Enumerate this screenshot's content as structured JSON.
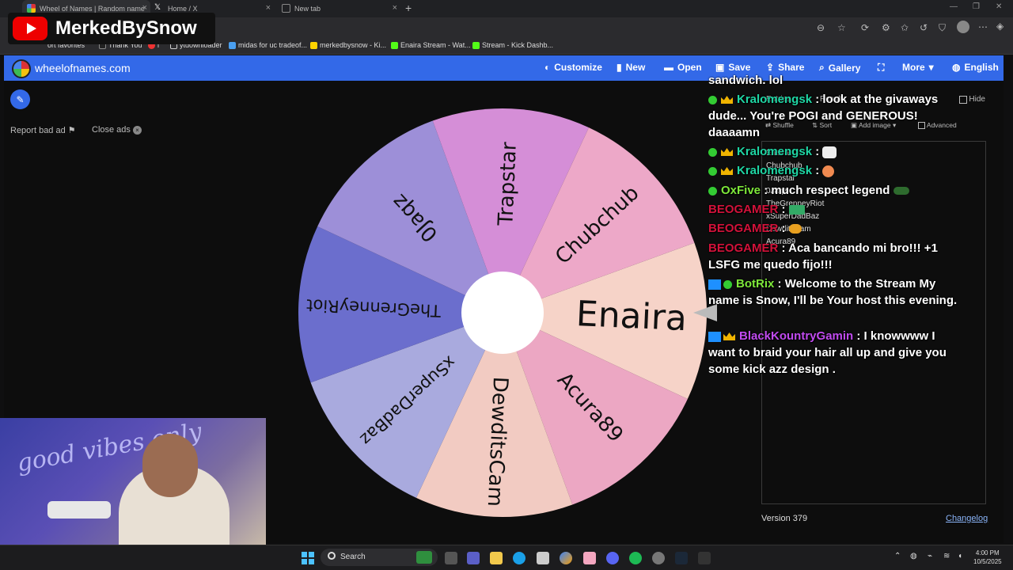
{
  "browser": {
    "tabs": [
      {
        "label": "Wheel of Names | Random name"
      },
      {
        "label": "Home / X"
      },
      {
        "label": "New tab"
      }
    ],
    "bookmarks": [
      "ort favorites",
      "Thank You",
      "i",
      "ytdownloader",
      "midas for uc tradeof...",
      "merkedbysnow - Ki...",
      "Enaira Stream - Wat...",
      "Stream - Kick Dashb..."
    ]
  },
  "overlay": {
    "channel_name": "MerkedBySnow"
  },
  "site": {
    "title": "wheelofnames.com",
    "nav": {
      "customize": "Customize",
      "new": "New",
      "open": "Open",
      "save": "Save",
      "share": "Share",
      "gallery": "Gallery",
      "more": "More",
      "language": "English"
    },
    "report_ad": "Report bad ad",
    "close_ads": "Close ads"
  },
  "wheel": {
    "segments": [
      {
        "label": "Enaira",
        "color": "#f6d3c8"
      },
      {
        "label": "Acura89",
        "color": "#eca7c3"
      },
      {
        "label": "DewditsCam",
        "color": "#f2cbc2"
      },
      {
        "label": "xSuperDadBaz",
        "color": "#a9aade"
      },
      {
        "label": "TheGrenneyRiot",
        "color": "#6b6ecd"
      },
      {
        "label": "0Jaqz",
        "color": "#9d8fd8"
      },
      {
        "label": "Trapstar",
        "color": "#d58ed7"
      },
      {
        "label": "Chubchub",
        "color": "#eda8c8"
      }
    ]
  },
  "panel": {
    "entries_title": "Entries",
    "results_title": "Results",
    "hide_label": "Hide",
    "shuffle": "Shuffle",
    "sort": "Sort",
    "add_image": "Add image",
    "advanced": "Advanced",
    "entries": [
      "Enaira",
      "Chubchub",
      "Trapstar",
      "0Jaqz",
      "TheGrenneyRiot",
      "xSuperDadBaz",
      "DewditsCam",
      "Acura89"
    ],
    "version": "Version 379",
    "changelog": "Changelog"
  },
  "chat": [
    {
      "user": "",
      "text": "sandwich. lol"
    },
    {
      "user": "Kralomengsk",
      "text": "look at the givaways dude... You're POGI and GENEROUS! daaaamn"
    },
    {
      "user": "Kralomengsk",
      "text": ""
    },
    {
      "user": "Kralomengsk",
      "text": ""
    },
    {
      "user": "OxFive",
      "text": "much respect legend"
    },
    {
      "user": "BEOGAMER",
      "text": ""
    },
    {
      "user": "BEOGAMER",
      "text": ""
    },
    {
      "user": "BEOGAMER",
      "text": "Aca bancando mi bro!!! +1 LSFG me quedo fijo!!!"
    },
    {
      "user": "BotRix",
      "text": "Welcome to the Stream My name is Snow, I'll be Your host this evening."
    },
    {
      "user": "BlackKountryGamin",
      "text": "I knowwww I want to braid your hair all up and give you some kick azz design ."
    }
  ],
  "webcam": {
    "sign": "good vibes only"
  },
  "taskbar": {
    "search_placeholder": "Search",
    "time": "4:00 PM",
    "date": "10/5/2025"
  }
}
